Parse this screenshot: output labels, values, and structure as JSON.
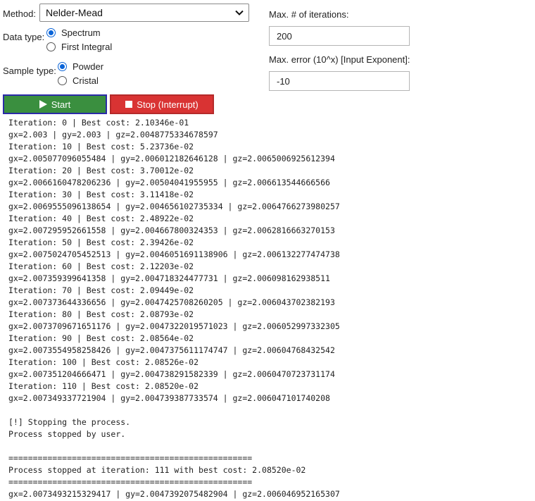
{
  "method": {
    "label": "Method:",
    "selected": "Nelder-Mead"
  },
  "data_type": {
    "label": "Data type:",
    "options": [
      {
        "label": "Spectrum",
        "checked": true
      },
      {
        "label": "First Integral",
        "checked": false
      }
    ]
  },
  "sample_type": {
    "label": "Sample type:",
    "options": [
      {
        "label": "Powder",
        "checked": true
      },
      {
        "label": "Cristal",
        "checked": false
      }
    ]
  },
  "max_iterations": {
    "label": "Max. # of iterations:",
    "value": "200"
  },
  "max_error": {
    "label": "Max. error (10^x) [Input Exponent]:",
    "value": "-10"
  },
  "buttons": {
    "start_label": "Start",
    "stop_label": "Stop (Interrupt)"
  },
  "colors": {
    "start": "#3a8f3f",
    "stop": "#d93333",
    "radio_accent": "#0a64d8"
  },
  "output_lines": [
    "Iteration: 0 | Best cost: 2.10346e-01",
    "gx=2.003 | gy=2.003 | gz=2.0048775334678597",
    "Iteration: 10 | Best cost: 5.23736e-02",
    "gx=2.005077096055484 | gy=2.006012182646128 | gz=2.0065006925612394",
    "Iteration: 20 | Best cost: 3.70012e-02",
    "gx=2.0066160478206236 | gy=2.00504041955955 | gz=2.006613544666566",
    "Iteration: 30 | Best cost: 3.11418e-02",
    "gx=2.0069555096138654 | gy=2.004656102735334 | gz=2.0064766273980257",
    "Iteration: 40 | Best cost: 2.48922e-02",
    "gx=2.007295952661558 | gy=2.004667800324353 | gz=2.0062816663270153",
    "Iteration: 50 | Best cost: 2.39426e-02",
    "gx=2.0075024705452513 | gy=2.0046051691138906 | gz=2.006132277474738",
    "Iteration: 60 | Best cost: 2.12203e-02",
    "gx=2.007359399641358 | gy=2.004718324477731 | gz=2.006098162938511",
    "Iteration: 70 | Best cost: 2.09449e-02",
    "gx=2.007373644336656 | gy=2.0047425708260205 | gz=2.006043702382193",
    "Iteration: 80 | Best cost: 2.08793e-02",
    "gx=2.0073709671651176 | gy=2.0047322019571023 | gz=2.006052997332305",
    "Iteration: 90 | Best cost: 2.08564e-02",
    "gx=2.0073554958258426 | gy=2.0047375611174747 | gz=2.00604768432542",
    "Iteration: 100 | Best cost: 2.08526e-02",
    "gx=2.007351204666471 | gy=2.004738291582339 | gz=2.0060470723731174",
    "Iteration: 110 | Best cost: 2.08520e-02",
    "gx=2.007349337721904 | gy=2.004739387733574 | gz=2.006047101740208",
    "",
    "[!] Stopping the process.",
    "Process stopped by user.",
    "",
    "==================================================",
    "Process stopped at iteration: 111 with best cost: 2.08520e-02",
    "==================================================",
    "gx=2.0073493215329417 | gy=2.0047392075482904 | gz=2.006046952165307"
  ]
}
